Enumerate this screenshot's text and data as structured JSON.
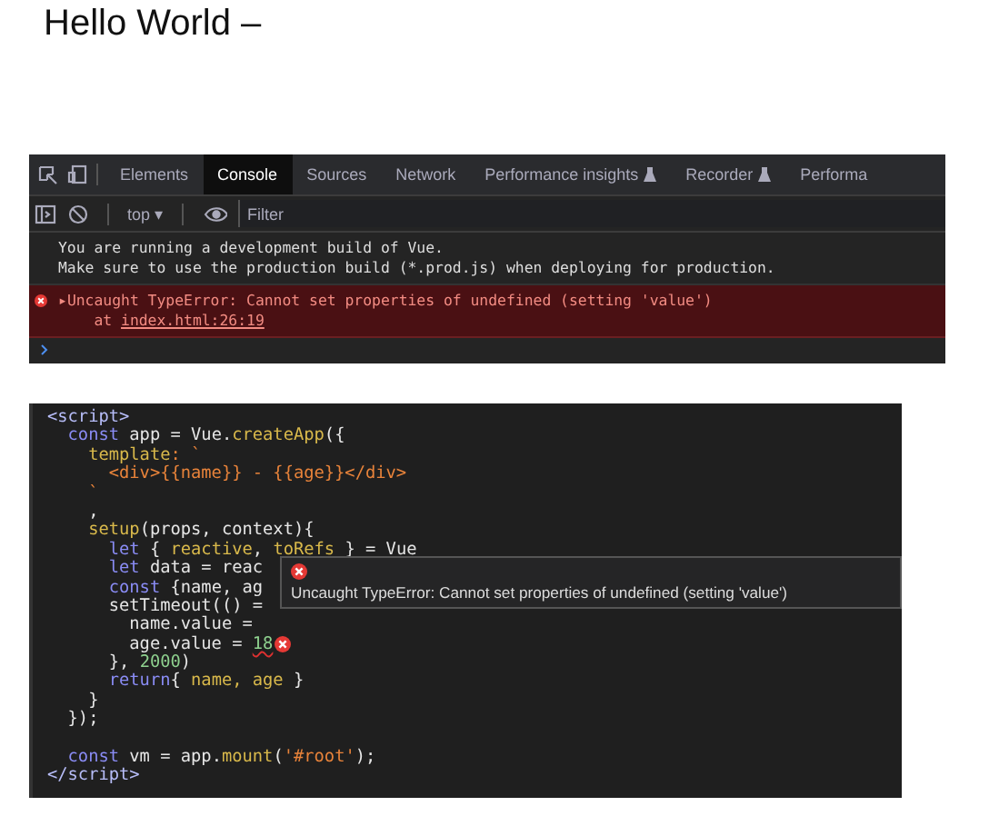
{
  "heading": "Hello World –",
  "devtools": {
    "tabs": [
      {
        "label": "Elements",
        "selected": false
      },
      {
        "label": "Console",
        "selected": true
      },
      {
        "label": "Sources",
        "selected": false
      },
      {
        "label": "Network",
        "selected": false
      },
      {
        "label": "Performance insights",
        "selected": false,
        "experimental": true
      },
      {
        "label": "Recorder",
        "selected": false,
        "experimental": true
      },
      {
        "label": "Performa",
        "selected": false
      }
    ],
    "context": "top ▾",
    "filter": {
      "placeholder": "Filter"
    },
    "messages": [
      {
        "kind": "info",
        "lines": [
          "You are running a development build of Vue.",
          "Make sure to use the production build (*.prod.js) when deploying for production."
        ]
      },
      {
        "kind": "error",
        "expander": "▸",
        "text": "Uncaught TypeError: Cannot set properties of undefined (setting 'value')",
        "prefix": "at",
        "location": "index.html:26:19"
      }
    ]
  },
  "code": {
    "lines": [
      {
        "kind": "code",
        "tokens": [
          {
            "t": "<script>",
            "kind": "tag"
          }
        ]
      },
      {
        "kind": "code",
        "tokens": [
          {
            "t": "  const",
            "kind": "keyword"
          },
          {
            "t": " app = Vue.",
            "kind": "plain"
          },
          {
            "t": "createApp",
            "kind": "function"
          },
          {
            "t": "({",
            "kind": "plain"
          }
        ]
      },
      {
        "kind": "code",
        "tokens": [
          {
            "t": "    template",
            "kind": "function"
          },
          {
            "t": ": `",
            "kind": "string"
          }
        ]
      },
      {
        "kind": "code",
        "tokens": [
          {
            "t": "      <div>{{name}} - {{age}}</div>",
            "kind": "string"
          }
        ]
      },
      {
        "kind": "code",
        "tokens": [
          {
            "t": "    `",
            "kind": "string"
          }
        ]
      },
      {
        "kind": "code",
        "tokens": [
          {
            "t": "    ,",
            "kind": "plain"
          }
        ]
      },
      {
        "kind": "code",
        "tokens": [
          {
            "t": "    setup",
            "kind": "function"
          },
          {
            "t": "(props, context){",
            "kind": "plain"
          }
        ]
      },
      {
        "kind": "code",
        "tokens": [
          {
            "t": "      let",
            "kind": "keyword"
          },
          {
            "t": " { ",
            "kind": "plain"
          },
          {
            "t": "reactive",
            "kind": "function"
          },
          {
            "t": ", ",
            "kind": "plain"
          },
          {
            "t": "toRefs",
            "kind": "function"
          },
          {
            "t": " } = Vue",
            "kind": "plain"
          }
        ]
      },
      {
        "kind": "code",
        "tokens": [
          {
            "t": "      let",
            "kind": "keyword"
          },
          {
            "t": " data = reac",
            "kind": "plain"
          }
        ]
      },
      {
        "kind": "code",
        "tokens": [
          {
            "t": "      const",
            "kind": "keyword"
          },
          {
            "t": " {name, ag",
            "kind": "plain"
          }
        ]
      },
      {
        "kind": "code",
        "tokens": [
          {
            "t": "      setTimeout(() =",
            "kind": "plain"
          }
        ]
      },
      {
        "kind": "code",
        "tokens": [
          {
            "t": "        name.value =",
            "kind": "plain"
          }
        ]
      },
      {
        "kind": "code",
        "error_marker": true,
        "tokens": [
          {
            "t": "        age.value = ",
            "kind": "plain"
          },
          {
            "t": "18",
            "kind": "number",
            "error": true
          }
        ]
      },
      {
        "kind": "code",
        "tokens": [
          {
            "t": "      }, ",
            "kind": "plain"
          },
          {
            "t": "2000",
            "kind": "number"
          },
          {
            "t": ")",
            "kind": "plain"
          }
        ]
      },
      {
        "kind": "code",
        "tokens": [
          {
            "t": "      return",
            "kind": "keyword"
          },
          {
            "t": "{ ",
            "kind": "plain"
          },
          {
            "t": "name, age",
            "kind": "function"
          },
          {
            "t": " }",
            "kind": "plain"
          }
        ]
      },
      {
        "kind": "code",
        "tokens": [
          {
            "t": "    }",
            "kind": "plain"
          }
        ]
      },
      {
        "kind": "code",
        "tokens": [
          {
            "t": "  });",
            "kind": "plain"
          }
        ]
      },
      {
        "kind": "blank"
      },
      {
        "kind": "code",
        "tokens": [
          {
            "t": "  const",
            "kind": "keyword"
          },
          {
            "t": " vm = app.",
            "kind": "plain"
          },
          {
            "t": "mount",
            "kind": "function"
          },
          {
            "t": "(",
            "kind": "plain"
          },
          {
            "t": "'#root'",
            "kind": "string"
          },
          {
            "t": ");",
            "kind": "plain"
          }
        ]
      },
      {
        "kind": "code",
        "tokens": [
          {
            "t": "</script>",
            "kind": "tag"
          }
        ]
      }
    ],
    "tooltip": {
      "text": "Uncaught TypeError: Cannot set properties of undefined (setting 'value')"
    }
  }
}
